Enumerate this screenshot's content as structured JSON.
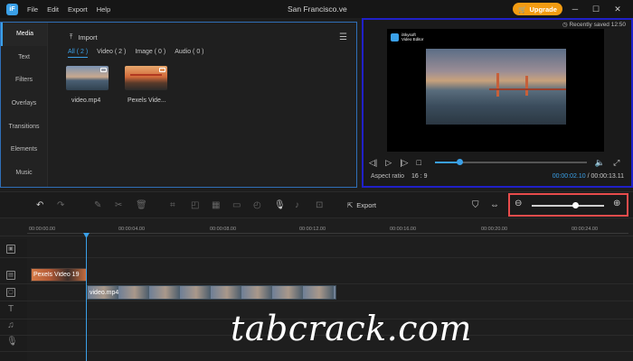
{
  "app": {
    "title": "San Francisco.ve",
    "menu": [
      "File",
      "Edit",
      "Export",
      "Help"
    ],
    "upgrade_label": "Upgrade",
    "logo_letter": "iF"
  },
  "sidebar": {
    "items": [
      {
        "label": "Media",
        "active": true
      },
      {
        "label": "Text"
      },
      {
        "label": "Filters"
      },
      {
        "label": "Overlays"
      },
      {
        "label": "Transitions"
      },
      {
        "label": "Elements"
      },
      {
        "label": "Music"
      }
    ]
  },
  "media": {
    "import_label": "Import",
    "filters": [
      "All ( 2 )",
      "Video ( 2 )",
      "Image ( 0 )",
      "Audio ( 0 )"
    ],
    "items": [
      {
        "label": "video.mp4"
      },
      {
        "label": "Pexels Vide..."
      }
    ]
  },
  "preview": {
    "saved_text": "Recently saved 12:50",
    "badge_line1": "iSkysoft",
    "badge_line2": "Video Editor",
    "progress": 0.16,
    "aspect_label": "Aspect ratio",
    "aspect_value": "16 : 9",
    "current_time": "00:00:02.10",
    "separator": "/",
    "total_time": "00:00:13.11"
  },
  "toolbar": {
    "export_label": "Export",
    "zoom_level": 0.6
  },
  "ruler": {
    "ticks": [
      "00:00:00.00",
      "00:00:04.00",
      "00:00:08.00",
      "00:00:12.00",
      "00:00:16.00",
      "00:00:20.00",
      "00:00:24.00"
    ]
  },
  "timeline": {
    "clip_top": "Pexels Video 19",
    "clip_main": "video.mp4"
  },
  "watermark": "tabcrack.com",
  "colors": {
    "accent": "#3aa0e8",
    "upgrade": "#f39c12",
    "preview_border": "#2020c8",
    "zoom_highlight": "#e84c4c"
  }
}
